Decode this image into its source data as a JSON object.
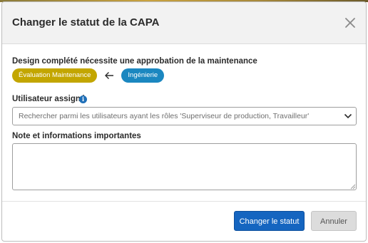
{
  "dialog": {
    "title": "Changer le statut de la CAPA",
    "close_icon": "close-icon"
  },
  "transition": {
    "message": "Design complété nécessite une approbation de la maintenance",
    "from_status": "Évaluation Maintenance",
    "to_status": "Ingénierie",
    "arrow_icon": "arrow-left-icon",
    "from_color": "#c3a600",
    "to_color": "#1b87c0"
  },
  "assigned_user": {
    "label": "Utilisateur assigné",
    "info_icon": "info-icon",
    "info_glyph": "i",
    "placeholder": "Rechercher parmi les utilisateurs ayant les rôles 'Superviseur de production, Travailleur'",
    "chevron_icon": "chevron-down-icon"
  },
  "notes": {
    "label": "Note et informations importantes",
    "value": ""
  },
  "actions": {
    "confirm_label": "Changer le statut",
    "cancel_label": "Annuler",
    "primary_color": "#1565c0"
  }
}
